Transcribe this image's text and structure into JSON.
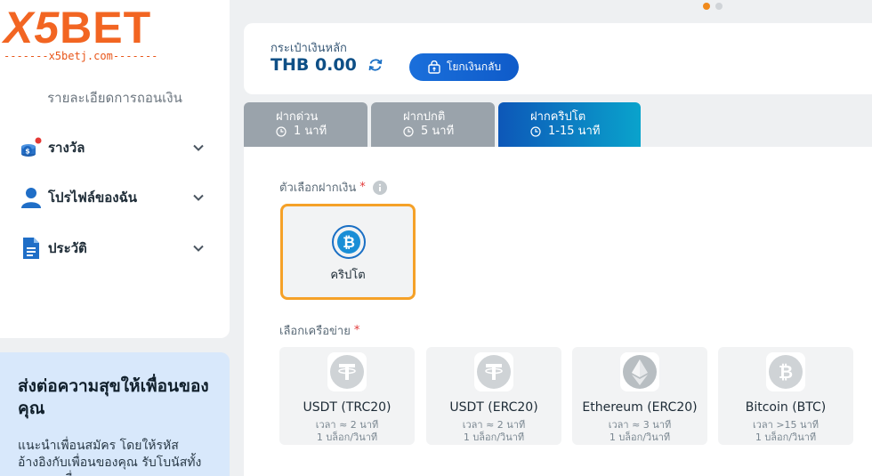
{
  "logo": {
    "brand_x5": "X5",
    "brand_bet": "BET",
    "tagline": "-------x5betj.com-------"
  },
  "sidebar": {
    "subtitle": "รายละเอียดการถอนเงิน",
    "items": [
      {
        "label": "รางวัล",
        "icon": "coins-icon"
      },
      {
        "label": "โปรไฟล์ของฉัน",
        "icon": "user-icon"
      },
      {
        "label": "ประวัติ",
        "icon": "document-icon"
      }
    ]
  },
  "referral": {
    "title": "ส่งต่อความสุขให้เพื่อนของคุณ",
    "body": "แนะนำเพื่อนสมัคร โดยให้รหัสอ้างอิงกับเพื่อนของคุณ รับโบนัสทั้งคุณและเพื่อน"
  },
  "wallet": {
    "label": "กระเป๋าเงินหลัก",
    "balance": "THB 0.00",
    "transfer_label": "โยกเงินกลับ"
  },
  "tabs": [
    {
      "title": "ฝากด่วน",
      "time": "1 นาที",
      "active": false
    },
    {
      "title": "ฝากปกติ",
      "time": "5 นาที",
      "active": false
    },
    {
      "title": "ฝากคริปโต",
      "time": "1-15 นาที",
      "active": true
    }
  ],
  "deposit": {
    "options_label": "ตัวเลือกฝากเงิน",
    "required_mark": "*",
    "method_label": "คริปโต",
    "network_label": "เลือกเครือข่าย"
  },
  "networks": [
    {
      "name": "USDT (TRC20)",
      "time": "เวลา ≈ 2 นาที",
      "speed": "1 บล็อก/วินาที",
      "icon": "tether-icon"
    },
    {
      "name": "USDT (ERC20)",
      "time": "เวลา ≈ 2 นาที",
      "speed": "1 บล็อก/วินาที",
      "icon": "tether-icon"
    },
    {
      "name": "Ethereum (ERC20)",
      "time": "เวลา ≈ 3 นาที",
      "speed": "1 บล็อก/วินาที",
      "icon": "ethereum-icon"
    },
    {
      "name": "Bitcoin (BTC)",
      "time": "เวลา >15 นาที",
      "speed": "1 บล็อก/วินาที",
      "icon": "bitcoin-icon"
    }
  ],
  "colors": {
    "accent": "#0e4f86",
    "selected_border": "#f5a128",
    "brand": "#f26522"
  }
}
